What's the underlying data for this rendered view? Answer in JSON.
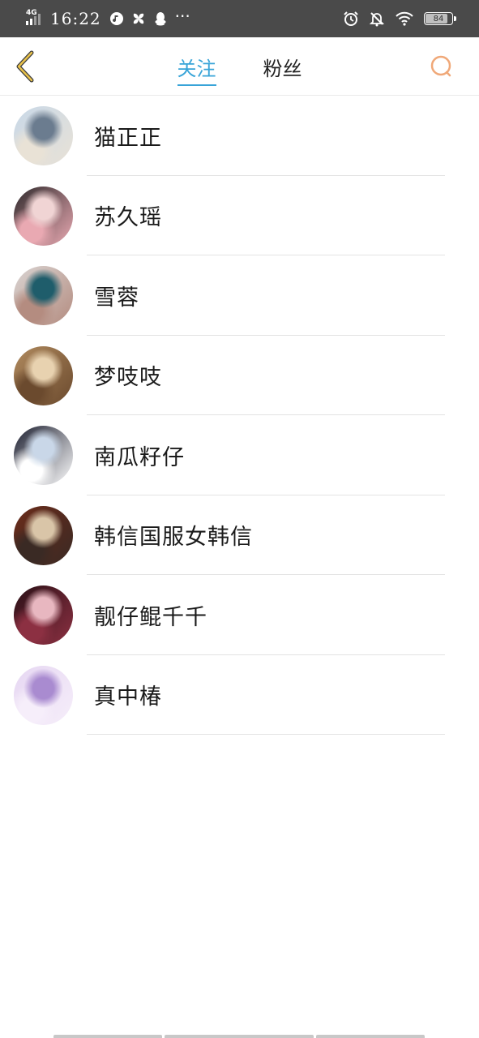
{
  "status_bar": {
    "network": "4G",
    "time": "16:22",
    "battery": "84",
    "battery_level": 0.84
  },
  "nav": {
    "tabs": [
      {
        "label": "关注",
        "active": true
      },
      {
        "label": "粉丝",
        "active": false
      }
    ],
    "back_icon": "chevron-left-icon",
    "search_icon": "search-icon"
  },
  "users": [
    {
      "name": "猫正正",
      "avatar_colors": [
        "#c8d8e8",
        "#6b7c8f",
        "#e9e2d6"
      ]
    },
    {
      "name": "苏久瑶",
      "avatar_colors": [
        "#2f2a2c",
        "#f0d4d4",
        "#e9a9b2"
      ]
    },
    {
      "name": "雪蓉",
      "avatar_colors": [
        "#d9d4d2",
        "#1f5d6b",
        "#b48c80"
      ]
    },
    {
      "name": "梦吱吱",
      "avatar_colors": [
        "#b08a5e",
        "#e8d2b0",
        "#6b4a2e"
      ]
    },
    {
      "name": "南瓜籽仔",
      "avatar_colors": [
        "#1a1d2e",
        "#c9d7e8",
        "#ffffff"
      ]
    },
    {
      "name": "韩信国服女韩信",
      "avatar_colors": [
        "#6b2b1a",
        "#d9c5a8",
        "#3a2a24"
      ]
    },
    {
      "name": "靓仔鲲千千",
      "avatar_colors": [
        "#2a1016",
        "#e8b7c0",
        "#8c3042"
      ]
    },
    {
      "name": "真中椿",
      "avatar_colors": [
        "#e6d7f2",
        "#a98bd0",
        "#f6eefa"
      ]
    }
  ]
}
